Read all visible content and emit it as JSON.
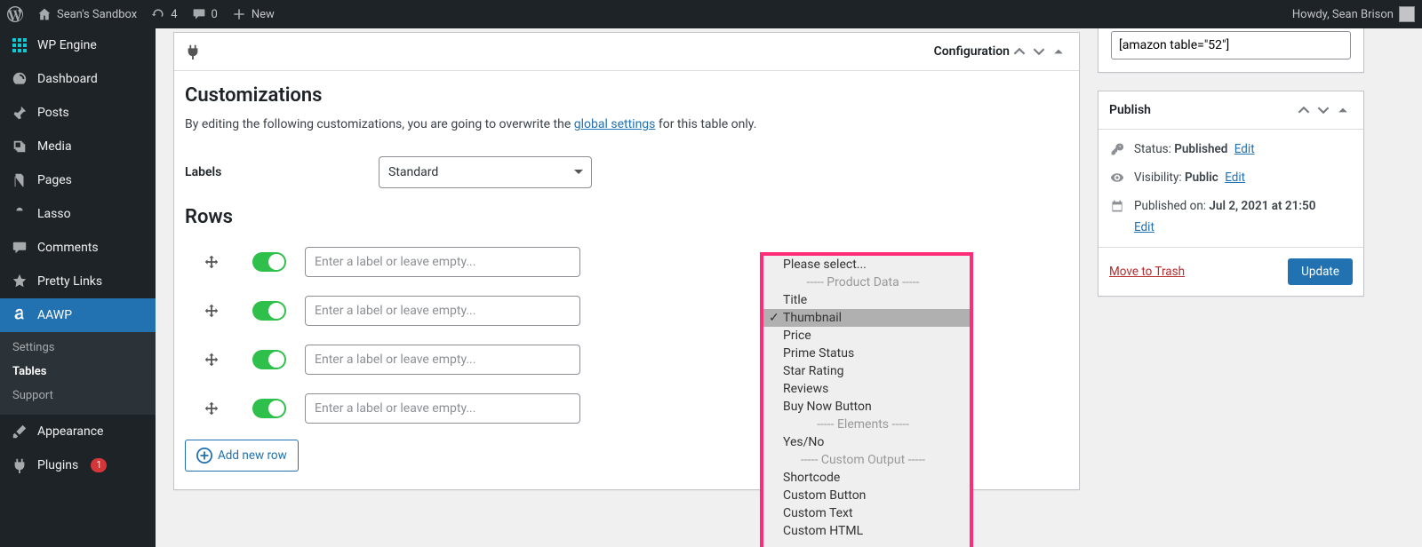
{
  "adminbar": {
    "site_name": "Sean's Sandbox",
    "updates_count": "4",
    "comments_count": "0",
    "new_label": "New",
    "howdy": "Howdy, Sean Brison"
  },
  "sidebar": {
    "items": [
      {
        "label": "WP Engine"
      },
      {
        "label": "Dashboard"
      },
      {
        "label": "Posts"
      },
      {
        "label": "Media"
      },
      {
        "label": "Pages"
      },
      {
        "label": "Lasso"
      },
      {
        "label": "Comments"
      },
      {
        "label": "Pretty Links"
      },
      {
        "label": "AAWP"
      },
      {
        "label": "Appearance"
      },
      {
        "label": "Plugins"
      }
    ],
    "aawp_sub": [
      {
        "label": "Settings"
      },
      {
        "label": "Tables"
      },
      {
        "label": "Support"
      }
    ],
    "plugins_badge": "1"
  },
  "config": {
    "header_title": "Configuration",
    "customizations_heading": "Customizations",
    "customizations_desc_pre": "By editing the following customizations, you are going to overwrite the ",
    "customizations_link": "global settings",
    "customizations_desc_post": " for this table only.",
    "labels_label": "Labels",
    "labels_value": "Standard",
    "rows_heading": "Rows",
    "row_placeholder": "Enter a label or leave empty...",
    "add_row_label": "Add new row"
  },
  "dropdown": {
    "options": [
      {
        "label": "Please select..."
      },
      {
        "label": "----- Product Data -----",
        "group": true
      },
      {
        "label": "Title"
      },
      {
        "label": "Thumbnail",
        "selected": true
      },
      {
        "label": "Price"
      },
      {
        "label": "Prime Status"
      },
      {
        "label": "Star Rating"
      },
      {
        "label": "Reviews"
      },
      {
        "label": "Buy Now Button"
      },
      {
        "label": "----- Elements -----",
        "group": true
      },
      {
        "label": "Yes/No"
      },
      {
        "label": "----- Custom Output -----",
        "group": true
      },
      {
        "label": "Shortcode"
      },
      {
        "label": "Custom Button"
      },
      {
        "label": "Custom Text"
      },
      {
        "label": "Custom HTML"
      }
    ]
  },
  "shortcode_box": {
    "value": "[amazon table=\"52\"]"
  },
  "publish": {
    "title": "Publish",
    "status_label": "Status: ",
    "status_value": "Published",
    "visibility_label": "Visibility: ",
    "visibility_value": "Public",
    "date_label": "Published on: ",
    "date_value": "Jul 2, 2021 at 21:50",
    "edit_label": "Edit",
    "trash_label": "Move to Trash",
    "update_label": "Update"
  }
}
